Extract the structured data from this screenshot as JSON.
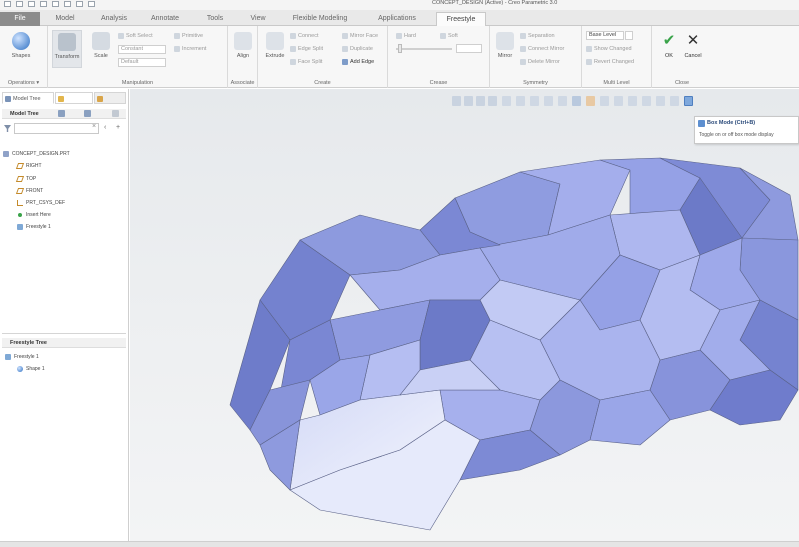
{
  "window": {
    "title": "CONCEPT_DESIGN (Active) - Creo Parametric 3.0"
  },
  "ribbon_tabs": [
    {
      "label": "File"
    },
    {
      "label": "Model"
    },
    {
      "label": "Analysis"
    },
    {
      "label": "Annotate"
    },
    {
      "label": "Tools"
    },
    {
      "label": "View"
    },
    {
      "label": "Flexible Modeling"
    },
    {
      "label": "Applications"
    },
    {
      "label": "Freestyle"
    }
  ],
  "ribbon": {
    "operations": {
      "shapes": "Shapes",
      "group": "Operations ▾"
    },
    "manipulation": {
      "transform": "Transform",
      "scale": "Scale",
      "soft_select": "Soft Select",
      "constant": "Constant",
      "default": "Default",
      "primitive": "Primitive",
      "increment": "Increment",
      "group": "Manipulation"
    },
    "associate": {
      "align": "Align",
      "group": "Associate"
    },
    "create": {
      "extrude": "Extrude",
      "connect": "Connect",
      "edge_split": "Edge Split",
      "face_split": "Face Split",
      "mirror_face": "Mirror Face",
      "duplicate": "Duplicate",
      "add_edge": "Add Edge",
      "group": "Create"
    },
    "crease": {
      "hard": "Hard",
      "soft": "Soft",
      "group": "Crease"
    },
    "symmetry": {
      "mirror": "Mirror",
      "separation": "Separation",
      "connect_mirror": "Connect Mirror",
      "delete_mirror": "Delete Mirror",
      "group": "Symmetry"
    },
    "multi_level": {
      "base_level": "Base Level",
      "show_changed": "Show Changed",
      "revert_changed": "Revert Changed",
      "group": "Multi Level"
    },
    "close": {
      "ok": "OK",
      "cancel": "Cancel",
      "group": "Close"
    }
  },
  "left_panel": {
    "tabs": [
      {
        "label": "Model Tree"
      },
      {
        "label": "Folder Browser"
      },
      {
        "label": "Favorites"
      }
    ],
    "model_tree_header": "Model Tree",
    "tree": [
      {
        "label": "CONCEPT_DESIGN.PRT",
        "icon": "part-icon"
      },
      {
        "label": "RIGHT",
        "icon": "datum-plane-icon"
      },
      {
        "label": "TOP",
        "icon": "datum-plane-icon"
      },
      {
        "label": "FRONT",
        "icon": "datum-plane-icon"
      },
      {
        "label": "PRT_CSYS_DEF",
        "icon": "csys-icon"
      },
      {
        "label": "Insert Here",
        "icon": "insert-here-icon"
      },
      {
        "label": "Freestyle 1",
        "icon": "freestyle-icon"
      }
    ],
    "freestyle_tree_header": "Freestyle Tree",
    "freestyle_tree": [
      {
        "label": "Freestyle 1",
        "icon": "freestyle-icon"
      },
      {
        "label": "Shape 1",
        "icon": "shape-icon"
      }
    ]
  },
  "tooltip": {
    "title": "Box Mode (Ctrl+B)",
    "description": "Toggle on or off box mode display"
  },
  "colors": {
    "model_face": "#9aa6e8",
    "model_face_light": "#c9d0f5",
    "model_face_dark": "#6c7ac8",
    "model_edge": "#5a6288",
    "ok_green": "#3aa34a",
    "cancel_dark": "#333333"
  }
}
